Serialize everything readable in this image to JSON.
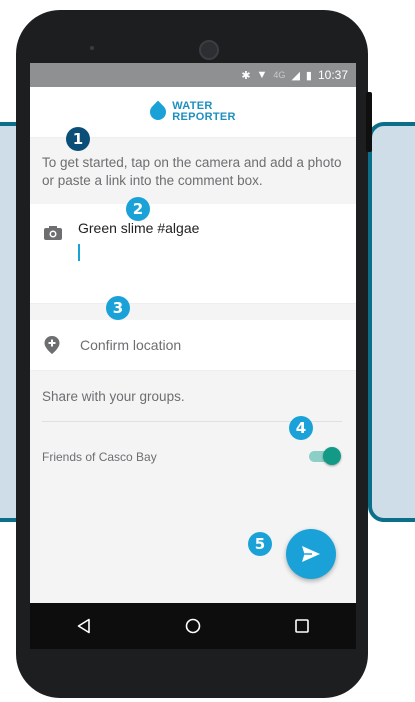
{
  "status_bar": {
    "time": "10:37",
    "network": "4G",
    "icons": [
      "bluetooth-icon",
      "wifi-icon",
      "signal-icon",
      "battery-icon"
    ]
  },
  "app": {
    "logo_line1": "WATER",
    "logo_line2": "REPORTER",
    "brand_color": "#1aa2d8"
  },
  "intro_text": "To get started, tap on the camera and add a photo or paste a link into the comment box.",
  "comment": {
    "value": "Green slime #algae",
    "icon": "camera-icon"
  },
  "location": {
    "label": "Confirm location",
    "icon": "location-pin-icon"
  },
  "groups": {
    "title": "Share with your groups.",
    "items": [
      {
        "name": "Friends of Casco Bay",
        "enabled": true
      }
    ]
  },
  "fab": {
    "icon": "send-icon"
  },
  "navigation": [
    "back-icon",
    "home-icon",
    "recents-icon"
  ],
  "markers": [
    "1",
    "2",
    "3",
    "4",
    "5"
  ],
  "colors": {
    "toggle_on": "#129a86",
    "marker": "#1aa2d8",
    "callout_border": "#0b6f8a",
    "callout_fill": "#cfdde8"
  }
}
